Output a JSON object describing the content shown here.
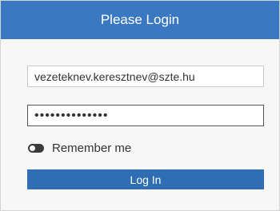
{
  "header": {
    "title": "Please Login"
  },
  "form": {
    "email_value": "vezeteknev.keresztnev@szte.hu",
    "password_value": "••••••••••••••",
    "remember_label": "Remember me",
    "remember_checked": false,
    "login_label": "Log In"
  },
  "colors": {
    "header_bg": "#3a78c2",
    "button_bg": "#2f6eb5"
  }
}
